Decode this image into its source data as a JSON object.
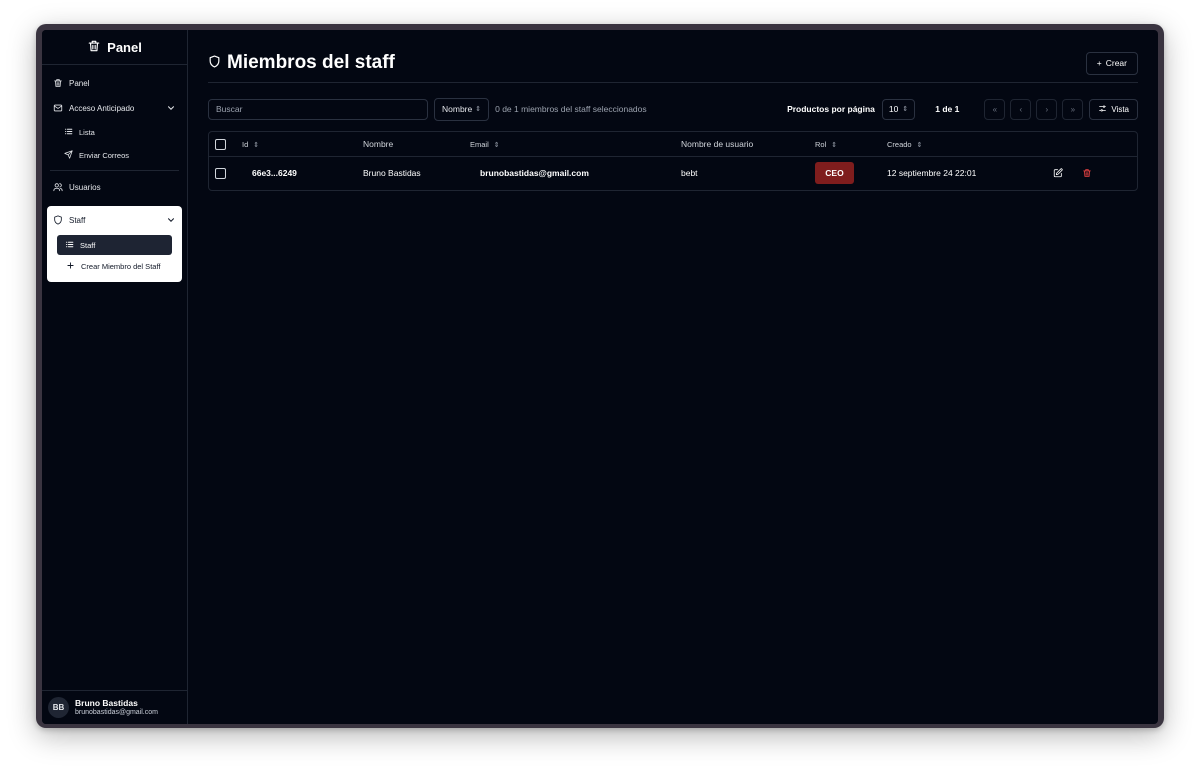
{
  "brand": {
    "title": "Panel"
  },
  "sidebar": {
    "items": [
      {
        "label": "Panel"
      },
      {
        "label": "Acceso Anticipado",
        "children": [
          "Lista",
          "Enviar Correos"
        ]
      },
      {
        "label": "Usuarios"
      },
      {
        "label": "Staff",
        "children": [
          "Staff",
          "Crear Miembro del Staff"
        ]
      }
    ]
  },
  "user": {
    "initials": "BB",
    "name": "Bruno Bastidas",
    "email": "brunobastidas@gmail.com"
  },
  "page": {
    "title": "Miembros del staff",
    "create_label": "Crear"
  },
  "toolbar": {
    "search_placeholder": "Buscar",
    "sort_label": "Nombre",
    "selection_text": "0 de 1 miembros del staff seleccionados",
    "per_page_label": "Productos por página",
    "per_page_value": "10",
    "page_info": "1 de 1",
    "view_label": "Vista"
  },
  "table": {
    "columns": [
      "Id",
      "Nombre",
      "Email",
      "Nombre de usuario",
      "Rol",
      "Creado"
    ],
    "rows": [
      {
        "id": "66e3...6249",
        "name": "Bruno Bastidas",
        "email": "brunobastidas@gmail.com",
        "username": "bebt",
        "role": "CEO",
        "created": "12 septiembre 24 22:01"
      }
    ]
  },
  "colors": {
    "background": "#030712",
    "badge": "#7f1d1d",
    "delete_icon": "#ef4444"
  }
}
